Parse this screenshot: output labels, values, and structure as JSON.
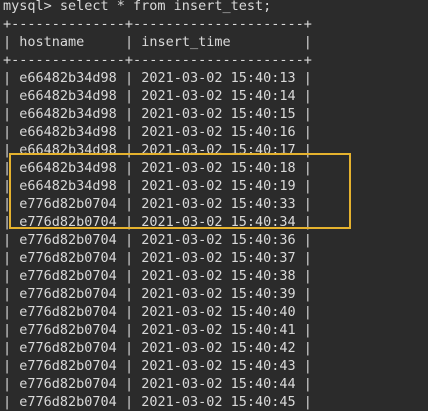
{
  "terminal": {
    "prompt_line": "mysql> select * from insert_test;",
    "border_line": "+--------------+---------------------+",
    "header": {
      "left_pipe": "|",
      "col1": " hostname     ",
      "sep": "|",
      "col2": " insert_time         ",
      "right_pipe": "|"
    },
    "rows": [
      {
        "hostname": "e66482b34d98",
        "insert_time": "2021-03-02 15:40:13"
      },
      {
        "hostname": "e66482b34d98",
        "insert_time": "2021-03-02 15:40:14"
      },
      {
        "hostname": "e66482b34d98",
        "insert_time": "2021-03-02 15:40:15"
      },
      {
        "hostname": "e66482b34d98",
        "insert_time": "2021-03-02 15:40:16"
      },
      {
        "hostname": "e66482b34d98",
        "insert_time": "2021-03-02 15:40:17"
      },
      {
        "hostname": "e66482b34d98",
        "insert_time": "2021-03-02 15:40:18"
      },
      {
        "hostname": "e66482b34d98",
        "insert_time": "2021-03-02 15:40:19"
      },
      {
        "hostname": "e776d82b0704",
        "insert_time": "2021-03-02 15:40:33"
      },
      {
        "hostname": "e776d82b0704",
        "insert_time": "2021-03-02 15:40:34"
      },
      {
        "hostname": "e776d82b0704",
        "insert_time": "2021-03-02 15:40:36"
      },
      {
        "hostname": "e776d82b0704",
        "insert_time": "2021-03-02 15:40:37"
      },
      {
        "hostname": "e776d82b0704",
        "insert_time": "2021-03-02 15:40:38"
      },
      {
        "hostname": "e776d82b0704",
        "insert_time": "2021-03-02 15:40:39"
      },
      {
        "hostname": "e776d82b0704",
        "insert_time": "2021-03-02 15:40:40"
      },
      {
        "hostname": "e776d82b0704",
        "insert_time": "2021-03-02 15:40:41"
      },
      {
        "hostname": "e776d82b0704",
        "insert_time": "2021-03-02 15:40:42"
      },
      {
        "hostname": "e776d82b0704",
        "insert_time": "2021-03-02 15:40:43"
      },
      {
        "hostname": "e776d82b0704",
        "insert_time": "2021-03-02 15:40:44"
      },
      {
        "hostname": "e776d82b0704",
        "insert_time": "2021-03-02 15:40:45"
      }
    ],
    "highlight_color": "#e5b22e",
    "background_color": "#2b2b2b",
    "text_color": "#d9d9d9"
  }
}
